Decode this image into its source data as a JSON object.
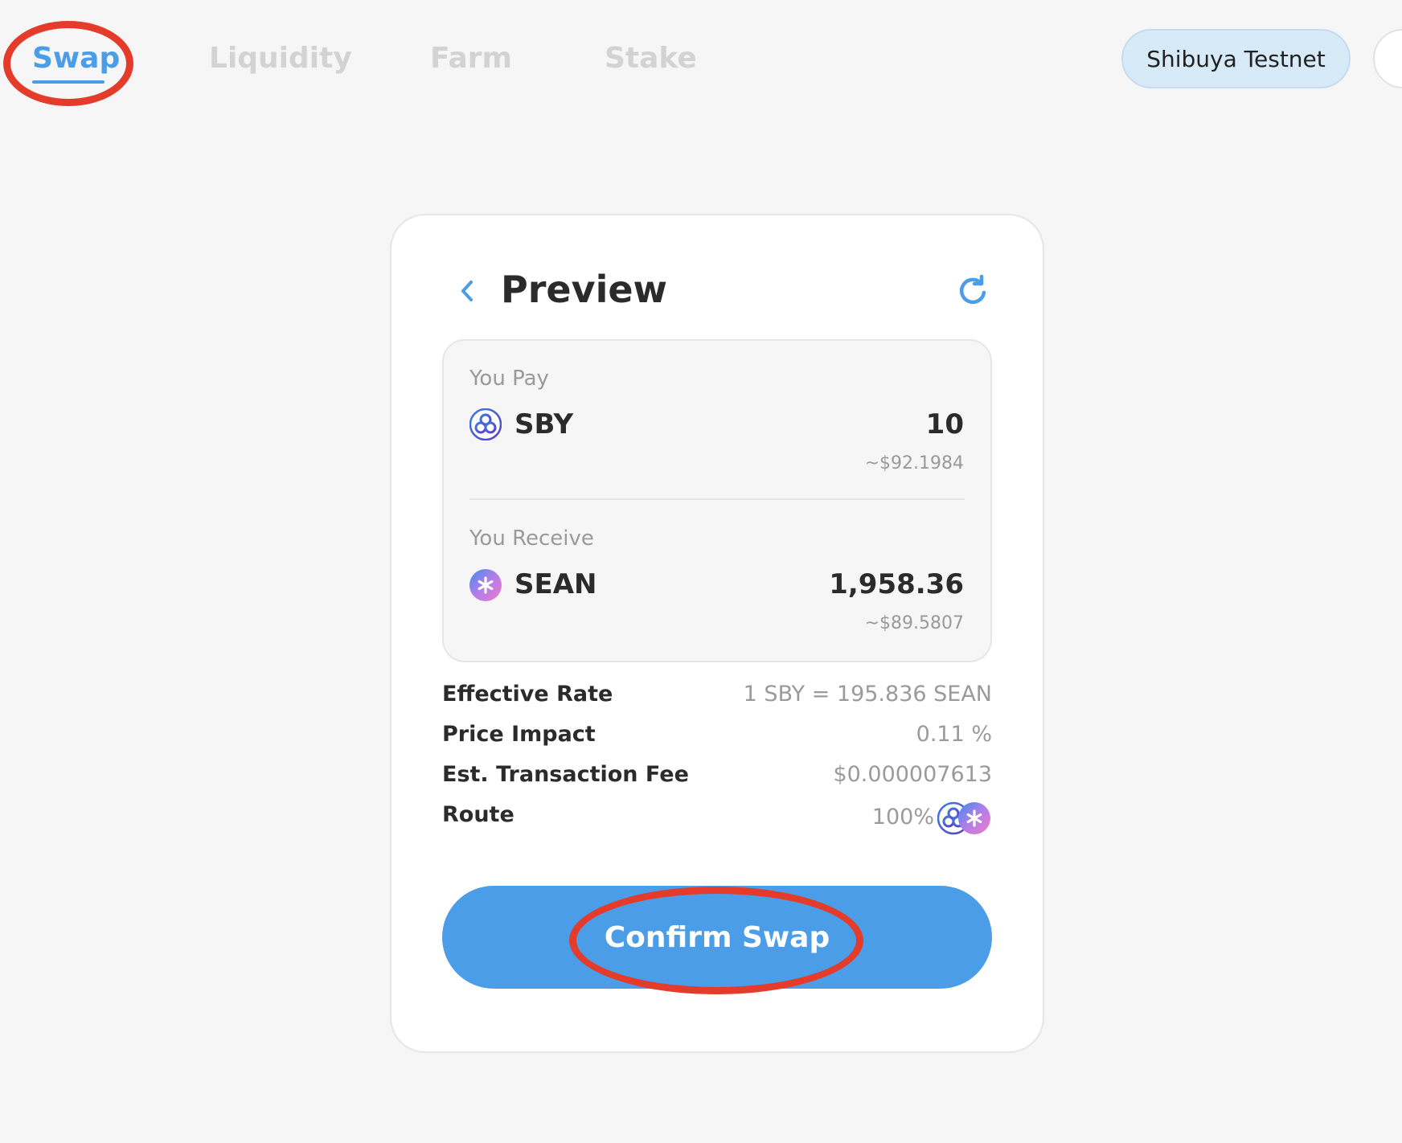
{
  "nav": {
    "items": [
      {
        "label": "Swap"
      },
      {
        "label": "Liquidity"
      },
      {
        "label": "Farm"
      },
      {
        "label": "Stake"
      }
    ],
    "network_label": "Shibuya Testnet"
  },
  "preview": {
    "title": "Preview",
    "pay": {
      "label": "You Pay",
      "token": "SBY",
      "amount": "10",
      "usd": "~$92.1984",
      "icon": "sby-token-icon"
    },
    "receive": {
      "label": "You Receive",
      "token": "SEAN",
      "amount": "1,958.36",
      "usd": "~$89.5807",
      "icon": "sean-token-icon"
    },
    "details": {
      "effective_rate": {
        "label": "Effective Rate",
        "value": "1 SBY = 195.836 SEAN"
      },
      "price_impact": {
        "label": "Price Impact",
        "value": "0.11 %"
      },
      "fee": {
        "label": "Est. Transaction Fee",
        "value": "$0.000007613"
      },
      "route": {
        "label": "Route",
        "value": "100%"
      }
    },
    "confirm_label": "Confirm Swap"
  },
  "colors": {
    "accent": "#4a9de6",
    "annotation": "#e53b2a",
    "network_pill_bg": "#d6eaf8"
  }
}
